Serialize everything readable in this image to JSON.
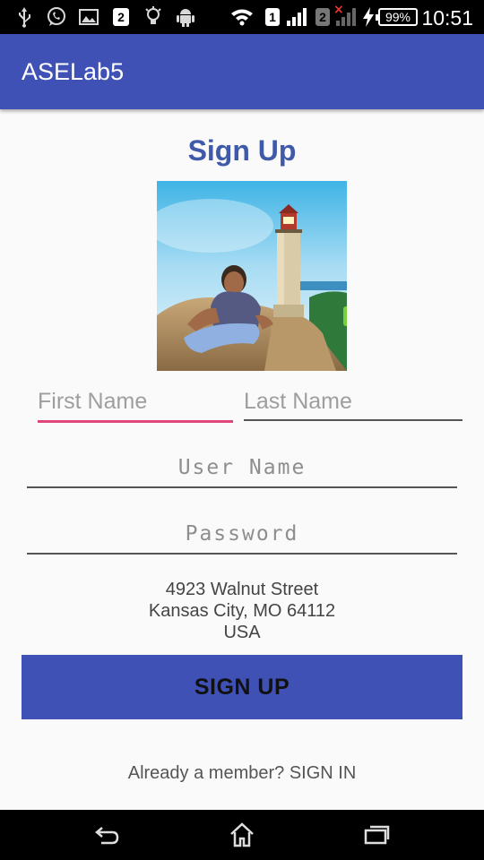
{
  "status_bar": {
    "time": "10:51",
    "battery_percent": "99%",
    "sim1_label": "1",
    "sim2_label": "2",
    "notification_badge": "2",
    "icons": [
      "usb-icon",
      "whatsapp-icon",
      "gallery-icon",
      "notification-count-icon",
      "bulb-icon",
      "android-icon",
      "wifi-icon",
      "sim1-signal-icon",
      "sim2-signal-icon",
      "charging-icon",
      "battery-icon"
    ]
  },
  "app_bar": {
    "title": "ASELab5"
  },
  "form": {
    "title": "Sign Up",
    "first_name_placeholder": "First Name",
    "last_name_placeholder": "Last Name",
    "user_name_placeholder": "User Name",
    "password_placeholder": "Password",
    "focused_field": "first_name",
    "accent_color": "#e0457b"
  },
  "address": {
    "line1": "4923 Walnut Street",
    "line2": "Kansas City, MO 64112",
    "line3": "USA"
  },
  "signup_button": {
    "label": "SIGN UP"
  },
  "signin_link": {
    "label": "Already a member? SIGN IN"
  },
  "nav_bar": {
    "icons": [
      "back-icon",
      "home-icon",
      "recents-icon"
    ]
  },
  "colors": {
    "primary": "#3f51b5",
    "title": "#3f5aa8"
  }
}
